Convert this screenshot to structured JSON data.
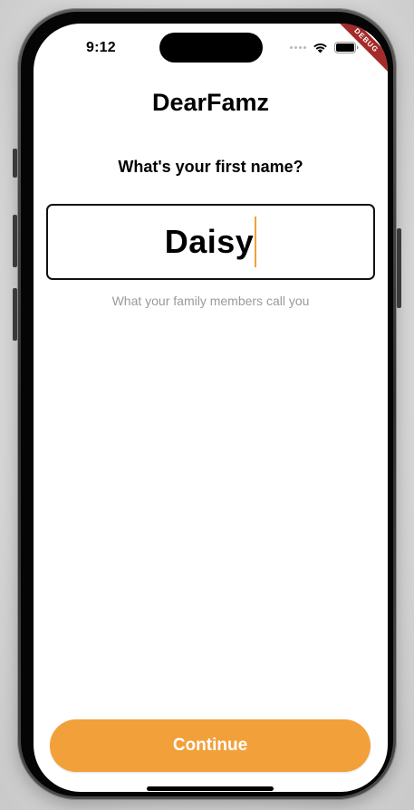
{
  "status_bar": {
    "time": "9:12",
    "debug_banner": "DEBUG",
    "icons": [
      "cellular-signal-icon",
      "wifi-icon",
      "battery-icon"
    ]
  },
  "app": {
    "title": "DearFamz"
  },
  "form": {
    "question": "What's your first name?",
    "name_value": "Daisy",
    "helper_text": "What your family members call you"
  },
  "actions": {
    "continue_label": "Continue"
  },
  "colors": {
    "accent": "#f2a03a",
    "helper_text": "#9a9a9a",
    "debug_banner": "#a52a2a",
    "background": "#ffffff"
  }
}
